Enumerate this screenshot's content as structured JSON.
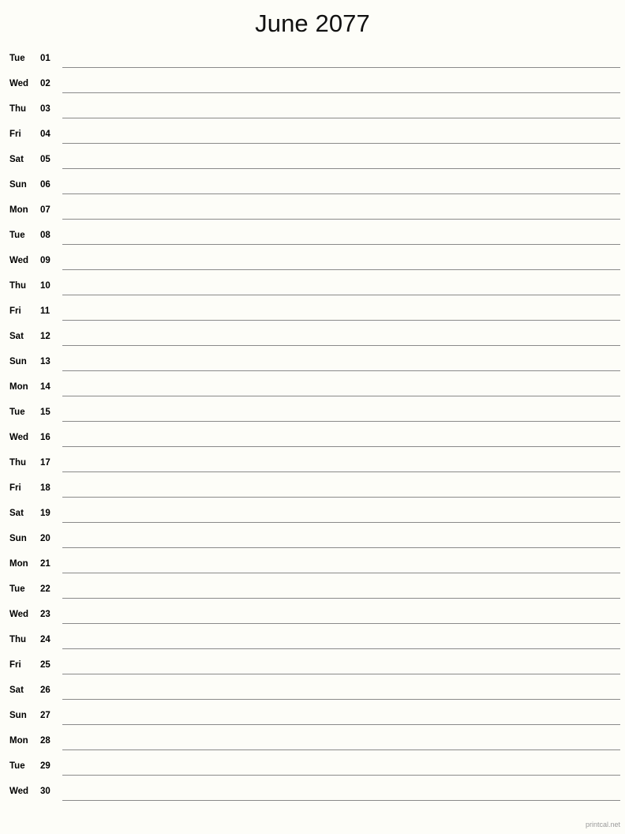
{
  "page": {
    "background_color": "#fdfdf8",
    "text_color": "#000000",
    "rule_color": "#8a8a8a",
    "footer_color": "#9a9a9a"
  },
  "header": {
    "title": "June 2077",
    "month": "June",
    "year": "2077"
  },
  "calendar": {
    "days": [
      {
        "weekday": "Tue",
        "number": "01"
      },
      {
        "weekday": "Wed",
        "number": "02"
      },
      {
        "weekday": "Thu",
        "number": "03"
      },
      {
        "weekday": "Fri",
        "number": "04"
      },
      {
        "weekday": "Sat",
        "number": "05"
      },
      {
        "weekday": "Sun",
        "number": "06"
      },
      {
        "weekday": "Mon",
        "number": "07"
      },
      {
        "weekday": "Tue",
        "number": "08"
      },
      {
        "weekday": "Wed",
        "number": "09"
      },
      {
        "weekday": "Thu",
        "number": "10"
      },
      {
        "weekday": "Fri",
        "number": "11"
      },
      {
        "weekday": "Sat",
        "number": "12"
      },
      {
        "weekday": "Sun",
        "number": "13"
      },
      {
        "weekday": "Mon",
        "number": "14"
      },
      {
        "weekday": "Tue",
        "number": "15"
      },
      {
        "weekday": "Wed",
        "number": "16"
      },
      {
        "weekday": "Thu",
        "number": "17"
      },
      {
        "weekday": "Fri",
        "number": "18"
      },
      {
        "weekday": "Sat",
        "number": "19"
      },
      {
        "weekday": "Sun",
        "number": "20"
      },
      {
        "weekday": "Mon",
        "number": "21"
      },
      {
        "weekday": "Tue",
        "number": "22"
      },
      {
        "weekday": "Wed",
        "number": "23"
      },
      {
        "weekday": "Thu",
        "number": "24"
      },
      {
        "weekday": "Fri",
        "number": "25"
      },
      {
        "weekday": "Sat",
        "number": "26"
      },
      {
        "weekday": "Sun",
        "number": "27"
      },
      {
        "weekday": "Mon",
        "number": "28"
      },
      {
        "weekday": "Tue",
        "number": "29"
      },
      {
        "weekday": "Wed",
        "number": "30"
      }
    ]
  },
  "footer": {
    "credit": "printcal.net"
  }
}
